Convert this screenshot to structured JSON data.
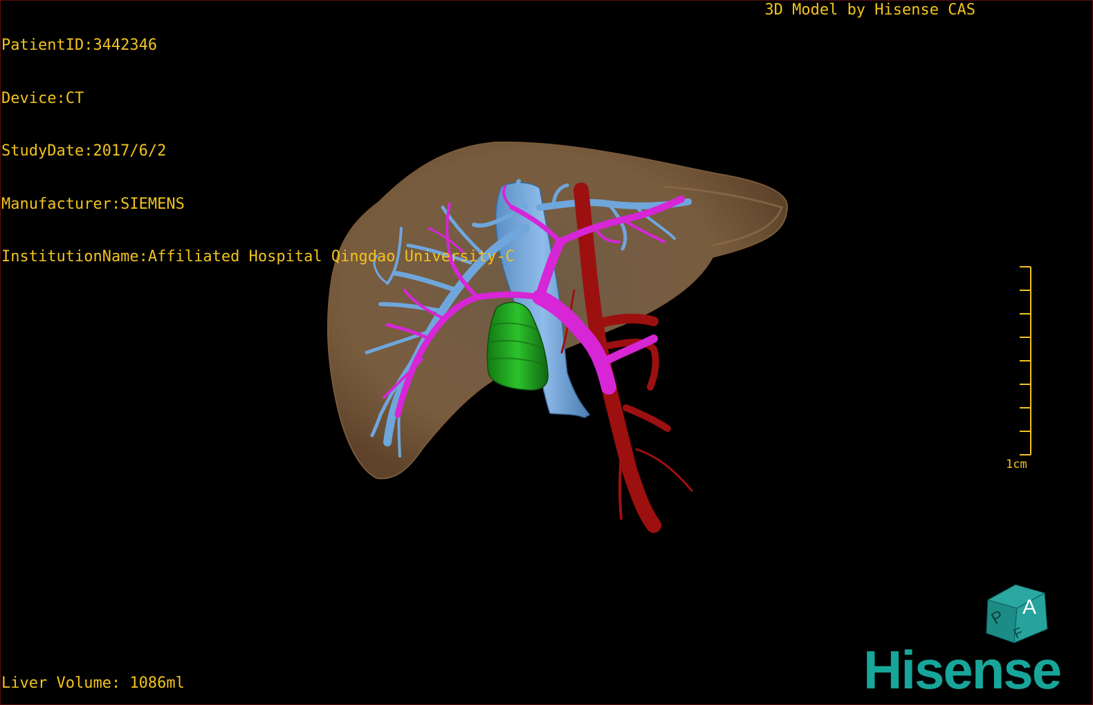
{
  "header": {
    "patient_id": "PatientID:3442346",
    "device": "Device:CT",
    "study_date": "StudyDate:2017/6/2",
    "manufacturer": "Manufacturer:SIEMENS",
    "institution": "InstitutionName:Affiliated Hospital Qingdao University-C",
    "brand_text": "3D Model by Hisense CAS"
  },
  "footer": {
    "liver_volume": "Liver Volume: 1086ml"
  },
  "scale_bar": {
    "label": "1cm"
  },
  "orientation_cube": {
    "face_top": "A",
    "face_side": "P",
    "face_front": "F"
  },
  "logo": {
    "text": "Hisense"
  },
  "model": {
    "structures": [
      "liver",
      "portal-vein",
      "hepatic-vein",
      "inferior-vena-cava",
      "hepatic-artery",
      "tumor"
    ],
    "colors": {
      "background": "#000000",
      "overlay_text": "#f2c31f",
      "liver": "#a07a52",
      "portal_vein": "#d626d6",
      "hepatic_vein": "#6fa6dc",
      "artery": "#9d1010",
      "tumor": "#1f9a1f",
      "logo": "#18a59a"
    }
  }
}
